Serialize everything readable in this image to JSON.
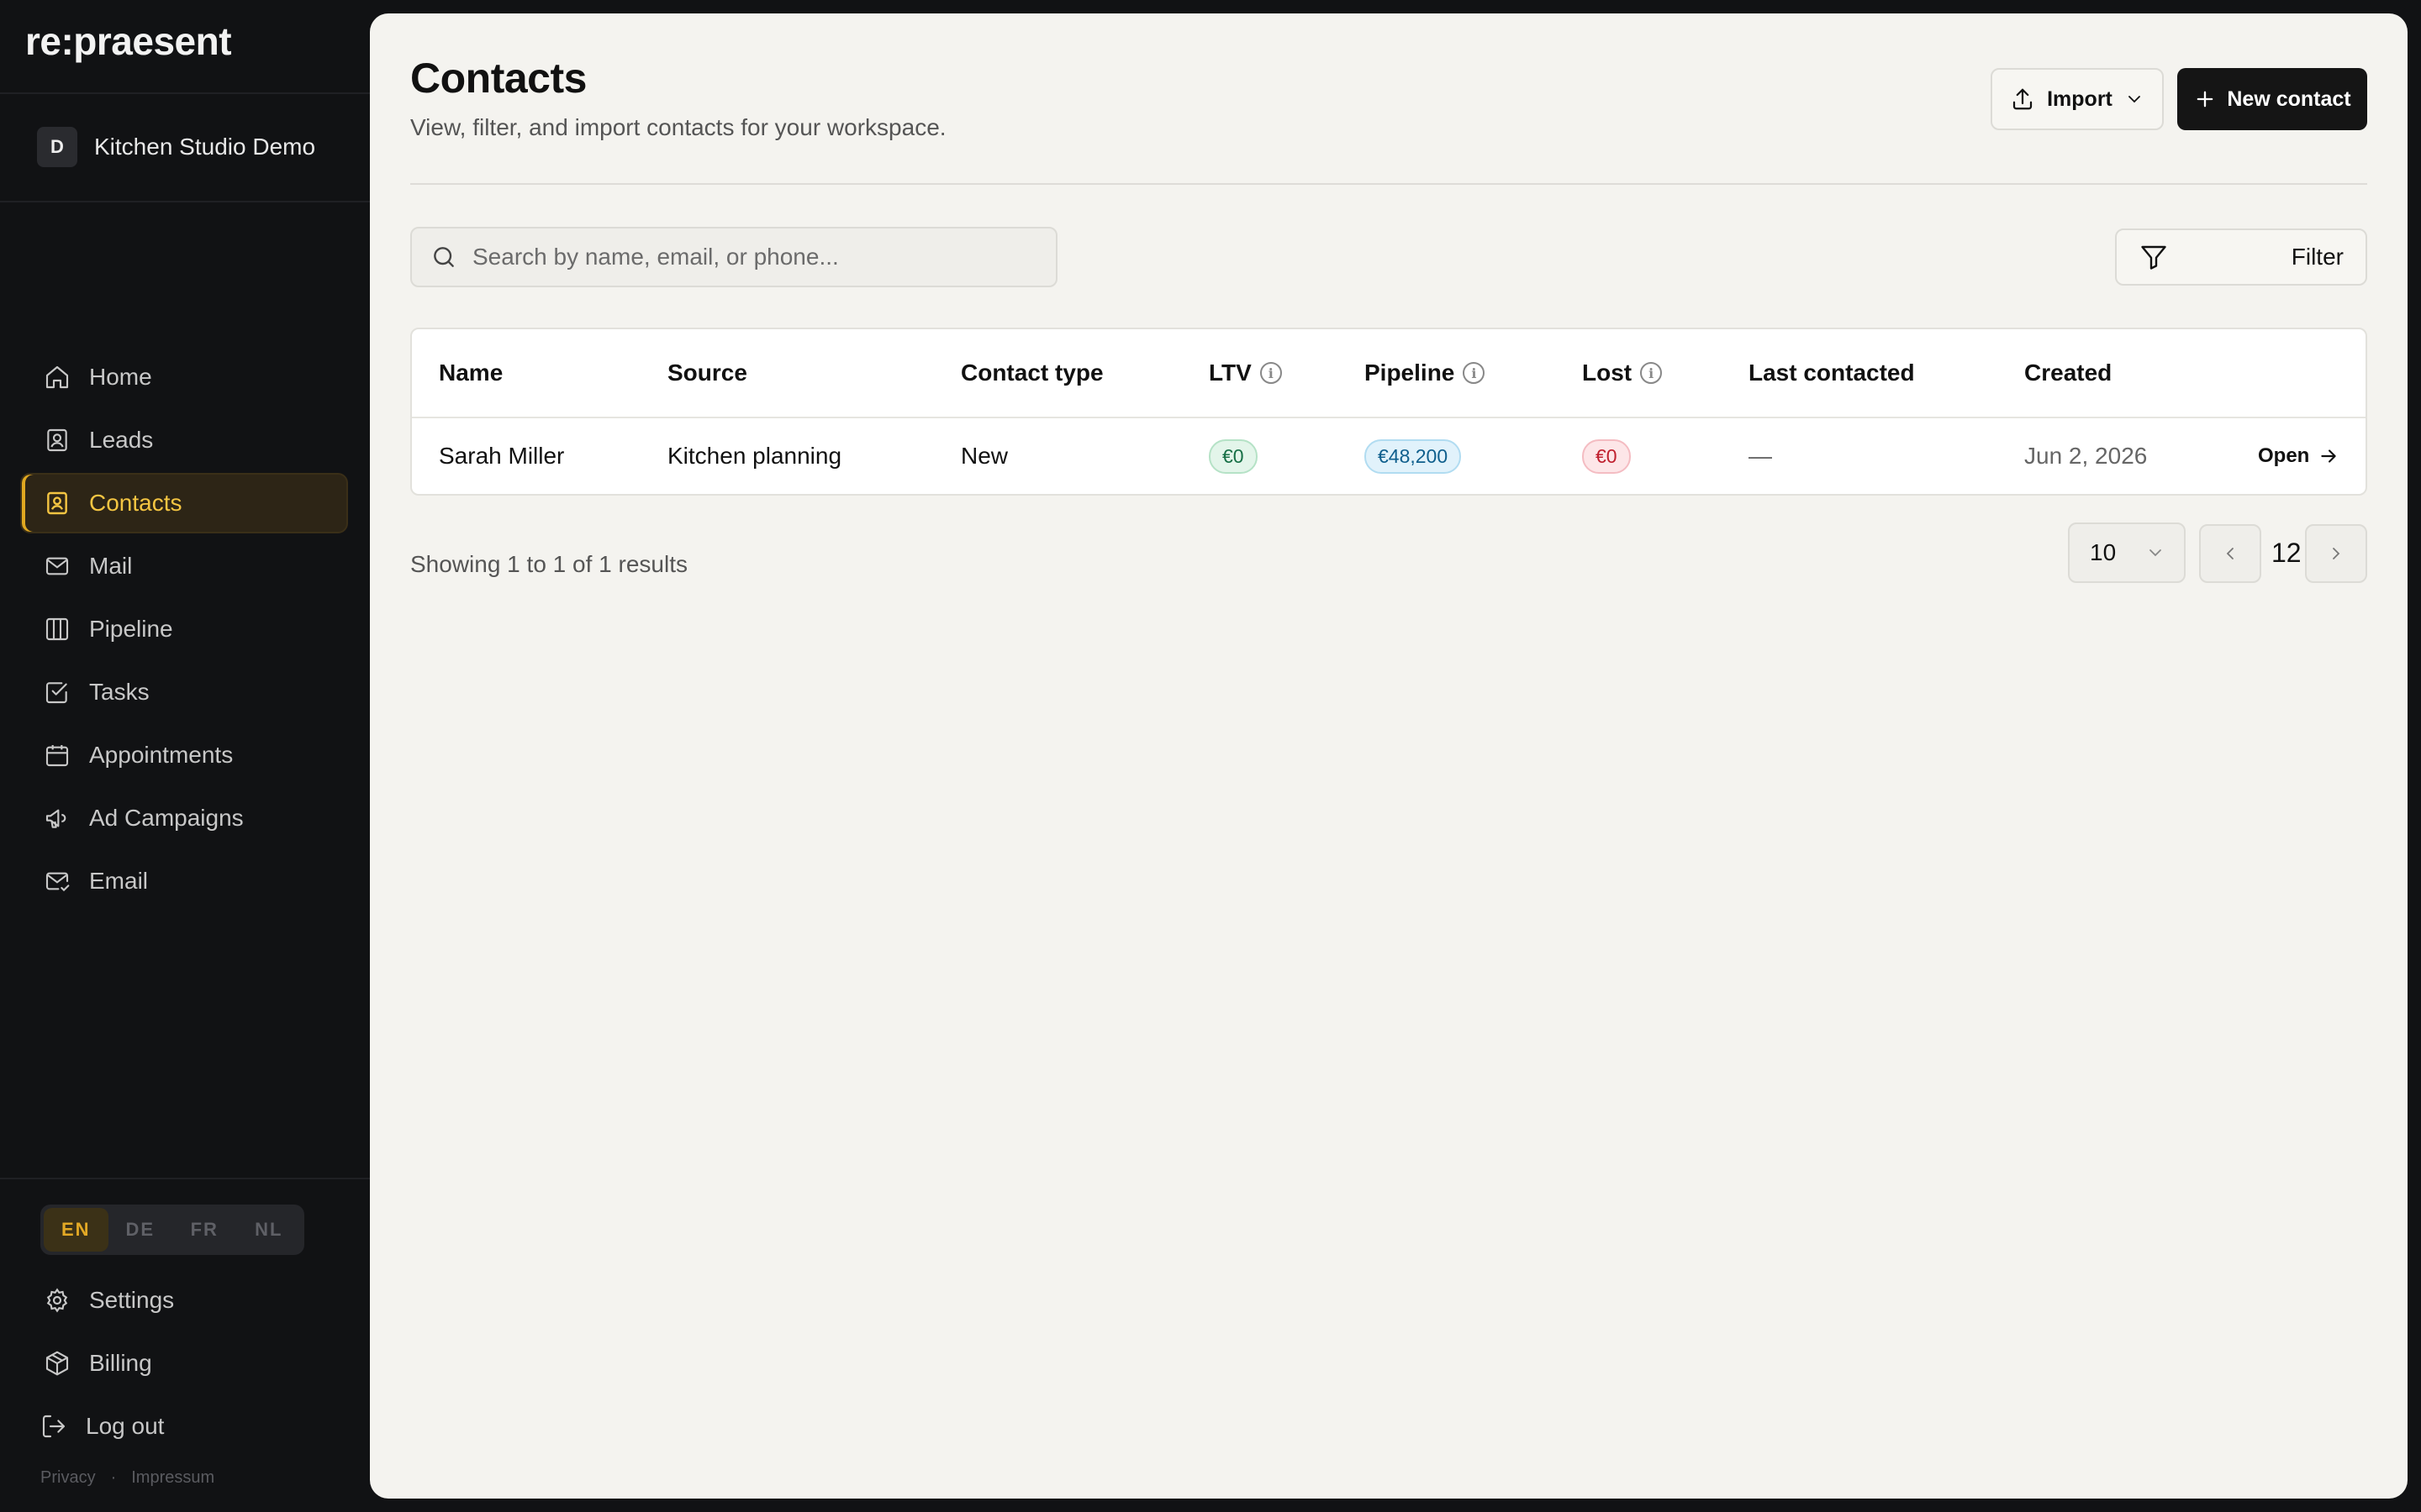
{
  "app": {
    "logo": "re:praesent"
  },
  "workspace": {
    "initial": "D",
    "name": "Kitchen Studio Demo"
  },
  "nav": {
    "items": [
      {
        "label": "Home",
        "icon": "home-icon"
      },
      {
        "label": "Leads",
        "icon": "id-badge-icon"
      },
      {
        "label": "Contacts",
        "icon": "contact-book-icon",
        "active": true
      },
      {
        "label": "Mail",
        "icon": "mail-icon"
      },
      {
        "label": "Pipeline",
        "icon": "columns-icon"
      },
      {
        "label": "Tasks",
        "icon": "checkbox-icon"
      },
      {
        "label": "Appointments",
        "icon": "calendar-icon"
      },
      {
        "label": "Ad Campaigns",
        "icon": "megaphone-icon"
      },
      {
        "label": "Email",
        "icon": "mail-check-icon"
      }
    ]
  },
  "languages": {
    "options": [
      "EN",
      "DE",
      "FR",
      "NL"
    ],
    "selected": "EN"
  },
  "bottom_nav": {
    "settings": "Settings",
    "billing": "Billing",
    "logout": "Log out"
  },
  "legal": {
    "privacy": "Privacy",
    "impressum": "Impressum"
  },
  "header": {
    "title": "Contacts",
    "subtitle": "View, filter, and import contacts for your workspace.",
    "import_label": "Import",
    "new_contact_label": "New contact"
  },
  "search": {
    "placeholder": "Search by name, email, or phone..."
  },
  "filter": {
    "label": "Filter"
  },
  "table": {
    "columns": [
      "Name",
      "Source",
      "Contact type",
      "LTV",
      "Pipeline",
      "Lost",
      "Last contacted",
      "Created"
    ],
    "rows": [
      {
        "name": "Sarah Miller",
        "source": "Kitchen planning",
        "contact_type": "New",
        "ltv": "€0",
        "pipeline": "€48,200",
        "lost": "€0",
        "last_contacted": "—",
        "created": "Jun 2, 2026",
        "action": "Open"
      }
    ]
  },
  "pagination": {
    "summary": "Showing 1 to 1 of 1 results",
    "per_page": "10",
    "page": "12"
  },
  "colors": {
    "sidebar_bg": "#111214",
    "accent": "#f4c542",
    "main_bg": "#f4f3ef",
    "primary_button": "#151515"
  }
}
